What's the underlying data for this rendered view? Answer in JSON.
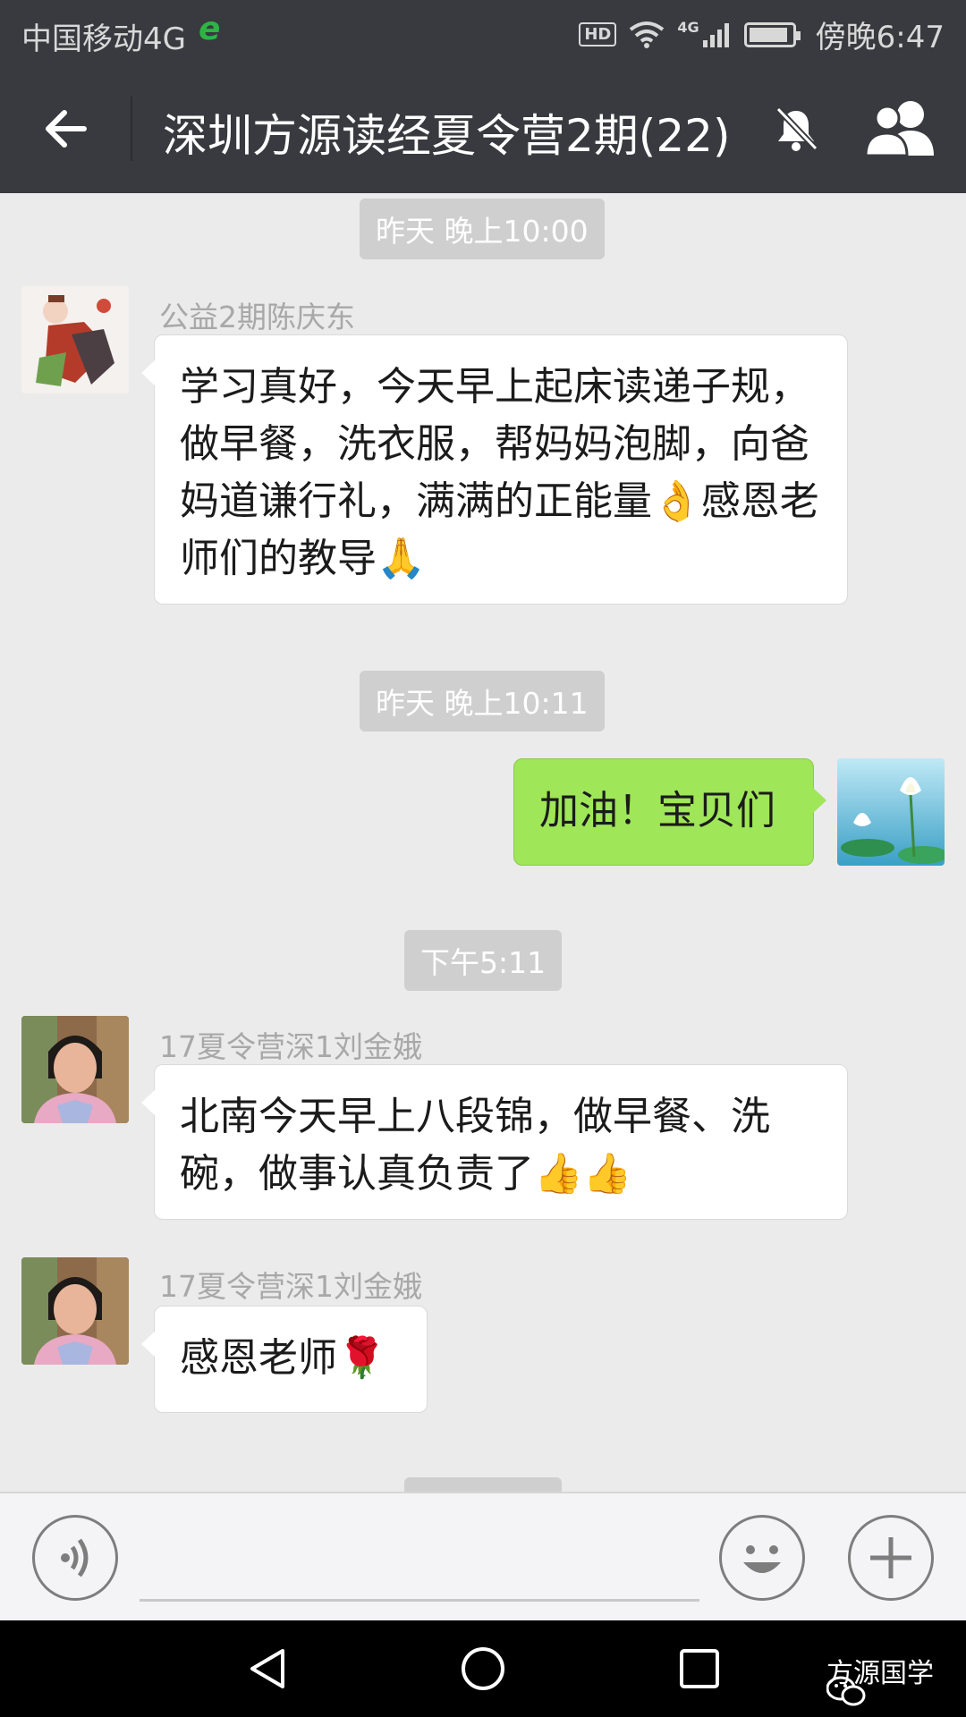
{
  "status_bar": {
    "carrier": "中国移动4G",
    "network_badge": "e",
    "hd_label": "HD",
    "signal_label": "4G",
    "time": "傍晚6:47"
  },
  "header": {
    "title": "深圳方源读经夏令营2期(22)",
    "back_icon": "arrow-left-icon",
    "mute_icon": "bell-off-icon",
    "members_icon": "group-members-icon"
  },
  "messages": [
    {
      "kind": "time",
      "text": "昨天 晚上10:00"
    },
    {
      "kind": "incoming",
      "sender": "公益2期陈庆东",
      "text": "学习真好，今天早上起床读递子规，做早餐，洗衣服，帮妈妈泡脚，向爸妈道谦行礼，满满的正能量👌感恩老师们的教导🙏",
      "avatar": "cartoon-avatar"
    },
    {
      "kind": "time",
      "text": "昨天 晚上10:11"
    },
    {
      "kind": "outgoing",
      "text": "加油！宝贝们",
      "avatar": "lotus-avatar"
    },
    {
      "kind": "time",
      "text": "下午5:11"
    },
    {
      "kind": "incoming",
      "sender": "17夏令营深1刘金娥",
      "text": "北南今天早上八段锦，做早餐、洗碗，做事认真负责了👍👍",
      "avatar": "woman-avatar"
    },
    {
      "kind": "incoming",
      "sender": "17夏令营深1刘金娥",
      "text": "感恩老师🌹",
      "avatar": "woman-avatar"
    }
  ],
  "input_bar": {
    "voice_icon": "voice-icon",
    "emoji_icon": "emoji-icon",
    "plus_icon": "plus-icon"
  },
  "watermark": {
    "text": "方源国学",
    "icon": "wechat-icon"
  },
  "colors": {
    "header_bg": "#393a3f",
    "chat_bg": "#ebebeb",
    "outgoing_bubble": "#9fe658",
    "incoming_bubble": "#ffffff"
  }
}
